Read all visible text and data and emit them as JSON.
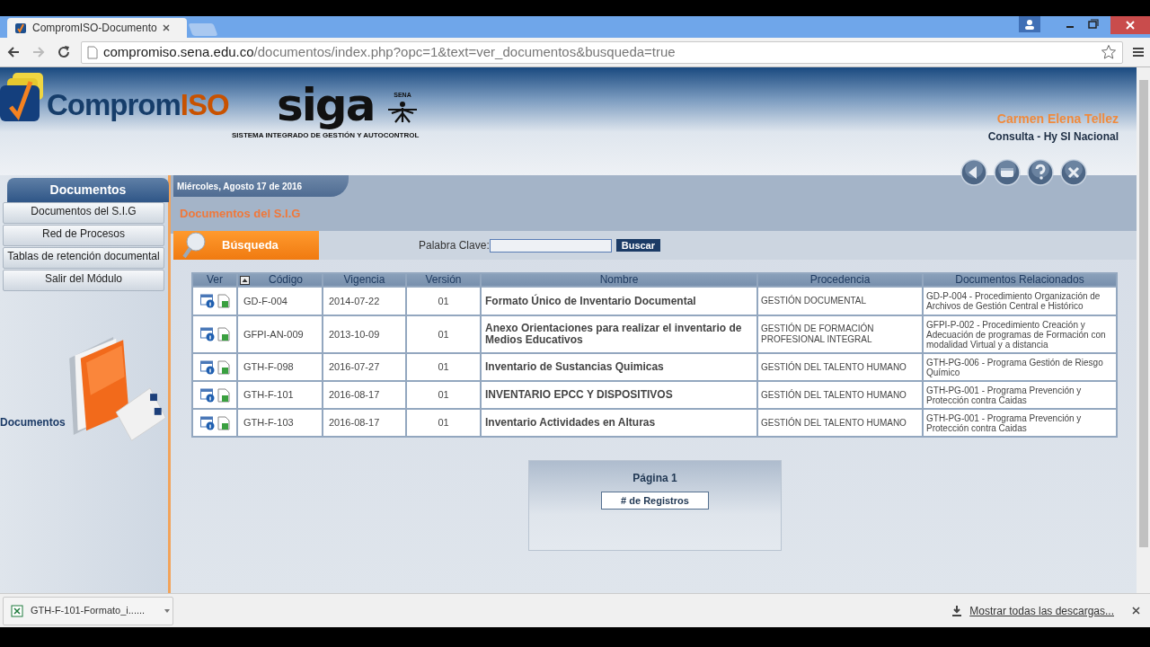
{
  "browser": {
    "tab_title": "CompromISO-Documento",
    "url_host": "compromiso.sena.edu.co",
    "url_path": "/documentos/index.php?opc=1&text=ver_documentos&busqueda=true"
  },
  "header": {
    "logo_main": "Comprom",
    "logo_accent": "ISO",
    "siga": "siga",
    "siga_subtitle": "SISTEMA INTEGRADO DE GESTIÓN Y AUTOCONTROL",
    "sena": "SENA",
    "user_name": "Carmen Elena Tellez",
    "user_role": "Consulta - Hy SI Nacional"
  },
  "sidebar": {
    "title": "Documentos",
    "items": [
      "Documentos del S.I.G",
      "Red de Procesos",
      "Tablas de retención documental",
      "Salir del Módulo"
    ],
    "caption": "Documentos"
  },
  "date": "Miércoles, Agosto 17 de 2016",
  "section_title": "Documentos del S.I.G",
  "search": {
    "tab_label": "Búsqueda",
    "field_label": "Palabra Clave:",
    "button": "Buscar"
  },
  "table": {
    "columns": [
      "Ver",
      "Código",
      "Vigencia",
      "Versión",
      "Nombre",
      "Procedencia",
      "Documentos Relacionados"
    ],
    "rows": [
      {
        "codigo": "GD-F-004",
        "vigencia": "2014-07-22",
        "version": "01",
        "nombre": "Formato Único de Inventario Documental",
        "procedencia": "GESTIÓN DOCUMENTAL",
        "relacionados": "GD-P-004 - Procedimiento Organización de Archivos de Gestión Central e Histórico"
      },
      {
        "codigo": "GFPI-AN-009",
        "vigencia": "2013-10-09",
        "version": "01",
        "nombre": "Anexo Orientaciones para realizar el inventario de Medios Educativos",
        "procedencia": "GESTIÓN DE FORMACIÓN PROFESIONAL INTEGRAL",
        "relacionados": "GFPI-P-002 - Procedimiento Creación y Adecuación de programas de Formación con modalidad Virtual y a distancia"
      },
      {
        "codigo": "GTH-F-098",
        "vigencia": "2016-07-27",
        "version": "01",
        "nombre": "Inventario de Sustancias Quimicas",
        "procedencia": "GESTIÓN DEL TALENTO HUMANO",
        "relacionados": "GTH-PG-006 - Programa Gestión de Riesgo Químico"
      },
      {
        "codigo": "GTH-F-101",
        "vigencia": "2016-08-17",
        "version": "01",
        "nombre": "INVENTARIO EPCC Y DISPOSITIVOS",
        "procedencia": "GESTIÓN DEL TALENTO HUMANO",
        "relacionados": "GTH-PG-001 - Programa Prevención y Protección contra Caidas"
      },
      {
        "codigo": "GTH-F-103",
        "vigencia": "2016-08-17",
        "version": "01",
        "nombre": "Inventario Actividades en Alturas",
        "procedencia": "GESTIÓN DEL TALENTO HUMANO",
        "relacionados": "GTH-PG-001 - Programa Prevención y Protección contra Caidas"
      }
    ]
  },
  "pager": {
    "page": "Página 1",
    "button": "# de Registros"
  },
  "downloads": {
    "file": "GTH-F-101-Formato_i......",
    "show_all": "Mostrar todas las descargas..."
  }
}
